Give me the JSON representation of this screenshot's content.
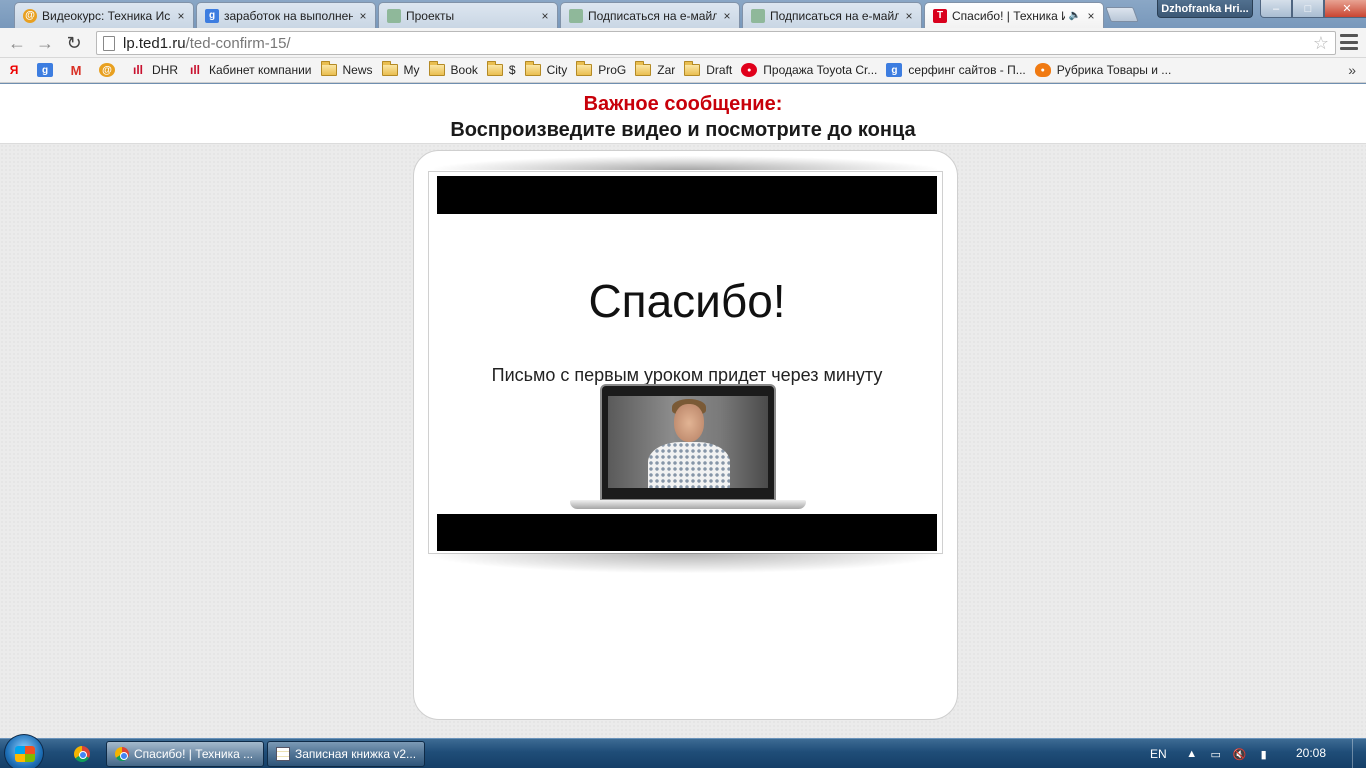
{
  "tabs": [
    {
      "title": "Видеокурс: Техника Ис",
      "icon": "orange-circle-icon",
      "color": "#e8a020"
    },
    {
      "title": "заработок на выполнен",
      "icon": "google-icon",
      "color": "#3d7de0"
    },
    {
      "title": "Проекты",
      "icon": "dots-favicon-icon",
      "color": "#8fb89a"
    },
    {
      "title": "Подписаться на e-майл",
      "icon": "dots-favicon-icon",
      "color": "#8fb89a"
    },
    {
      "title": "Подписаться на e-майл",
      "icon": "dots-favicon-icon",
      "color": "#8fb89a"
    },
    {
      "title": "Спасибо! | Техника И",
      "icon": "t-logo-icon",
      "color": "#d9001c",
      "active": true
    }
  ],
  "tab_close_glyph": "×",
  "profile_name": "Dzhofranka Hri...",
  "window_controls": {
    "minimize": "–",
    "maximize": "□",
    "close": "✕"
  },
  "toolbar": {
    "back": "←",
    "forward": "→",
    "reload": "↻",
    "url_host": "lp.ted1.ru",
    "url_path": "/ted-confirm-15/",
    "star": "☆"
  },
  "bookmarks": [
    {
      "label": "",
      "icon": "yandex-icon",
      "type": "icon",
      "color": "#ffffff",
      "glyph": "Я"
    },
    {
      "label": "",
      "icon": "google-icon",
      "type": "icon",
      "color": "#3d7de0",
      "glyph": "g"
    },
    {
      "label": "",
      "icon": "gmail-icon",
      "type": "icon",
      "color": "#ffffff",
      "glyph": "M"
    },
    {
      "label": "",
      "icon": "orange-circle-icon",
      "type": "icon",
      "color": "#e8a020",
      "glyph": "@"
    },
    {
      "label": "DHR",
      "icon": "red-bars-icon",
      "type": "icon",
      "color": "#c8102e",
      "glyph": "ıll"
    },
    {
      "label": "Кабинет компании",
      "icon": "red-bars-icon",
      "type": "icon",
      "color": "#c8102e",
      "glyph": "ıll"
    },
    {
      "label": "News",
      "icon": "folder-icon",
      "type": "folder"
    },
    {
      "label": "My",
      "icon": "folder-icon",
      "type": "folder"
    },
    {
      "label": "Book",
      "icon": "folder-icon",
      "type": "folder"
    },
    {
      "label": "$",
      "icon": "folder-icon",
      "type": "folder"
    },
    {
      "label": "City",
      "icon": "folder-icon",
      "type": "folder"
    },
    {
      "label": "ProG",
      "icon": "folder-icon",
      "type": "folder"
    },
    {
      "label": "Zar",
      "icon": "folder-icon",
      "type": "folder"
    },
    {
      "label": "Draft",
      "icon": "folder-icon",
      "type": "folder"
    },
    {
      "label": "Продажа Toyota Cr...",
      "icon": "toyota-icon",
      "type": "icon",
      "color": "#e0001b",
      "glyph": "●"
    },
    {
      "label": "серфинг сайтов - П...",
      "icon": "google-icon",
      "type": "icon",
      "color": "#3d7de0",
      "glyph": "g"
    },
    {
      "label": "Рубрика Товары и ...",
      "icon": "orange-badge-icon",
      "type": "icon",
      "color": "#f07a12",
      "glyph": "●"
    }
  ],
  "bookmarks_more": "»",
  "page": {
    "important": "Важное сообщение:",
    "subtitle": "Воспроизведите видео и посмотрите до конца",
    "video": {
      "thanks": "Спасибо!",
      "letter": "Письмо с первым уроком придет через минуту"
    }
  },
  "taskbar": {
    "tasks": [
      {
        "label": "Спасибо! | Техника ...",
        "icon": "chrome-icon",
        "active": true
      },
      {
        "label": "Записная книжка v2...",
        "icon": "notepad-icon",
        "active": false
      }
    ],
    "lang": "EN",
    "clock": "20:08"
  }
}
